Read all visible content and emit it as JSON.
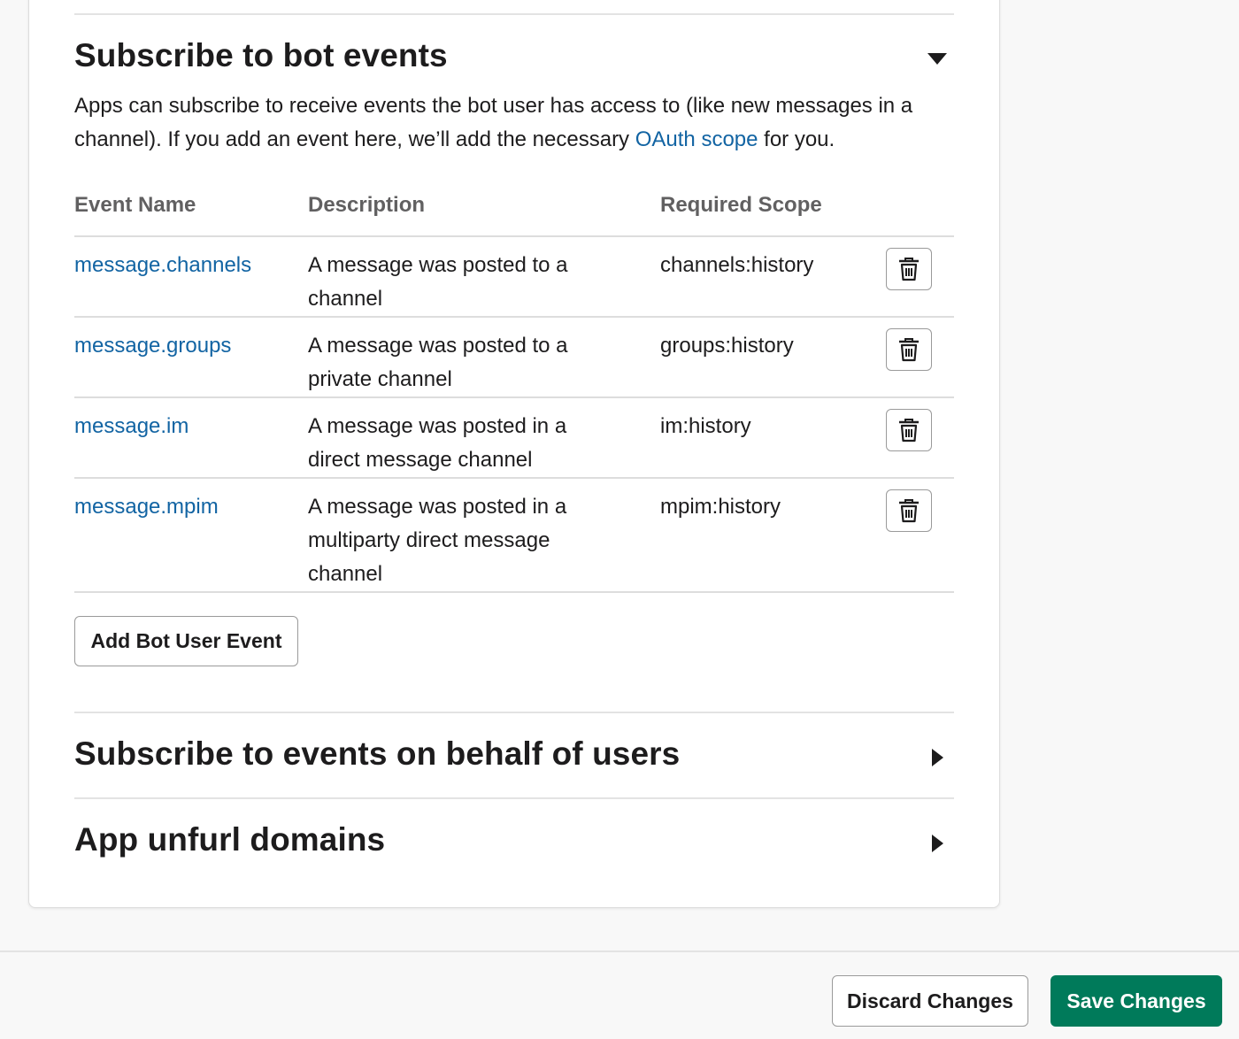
{
  "bot_events": {
    "title": "Subscribe to bot events",
    "description_before_link": "Apps can subscribe to receive events the bot user has access to (like new messages in a channel). If you add an event here, we’ll add the necessary ",
    "description_link": "OAuth scope",
    "description_after_link": " for you.",
    "columns": {
      "event_name": "Event Name",
      "description": "Description",
      "required_scope": "Required Scope"
    },
    "rows": [
      {
        "event": "message.channels",
        "description": [
          "A message was posted to a",
          "channel"
        ],
        "scope": "channels:history"
      },
      {
        "event": "message.groups",
        "description": [
          "A message was posted to a",
          "private channel"
        ],
        "scope": "groups:history"
      },
      {
        "event": "message.im",
        "description": [
          "A message was posted in a",
          "direct message channel"
        ],
        "scope": "im:history"
      },
      {
        "event": "message.mpim",
        "description": [
          "A message was posted in a",
          "multiparty direct message",
          "channel"
        ],
        "scope": "mpim:history"
      }
    ],
    "add_button_label": "Add Bot User Event",
    "caret_icon": "caret-down-icon"
  },
  "user_events": {
    "title": "Subscribe to events on behalf of users",
    "caret_icon": "caret-right-icon"
  },
  "unfurl": {
    "title": "App unfurl domains",
    "caret_icon": "caret-right-icon"
  },
  "footer": {
    "discard_label": "Discard Changes",
    "save_label": "Save Changes"
  },
  "colors": {
    "link": "#1264a3",
    "primary_button": "#007a5a",
    "text": "#1d1c1d",
    "muted_header": "#616061"
  }
}
